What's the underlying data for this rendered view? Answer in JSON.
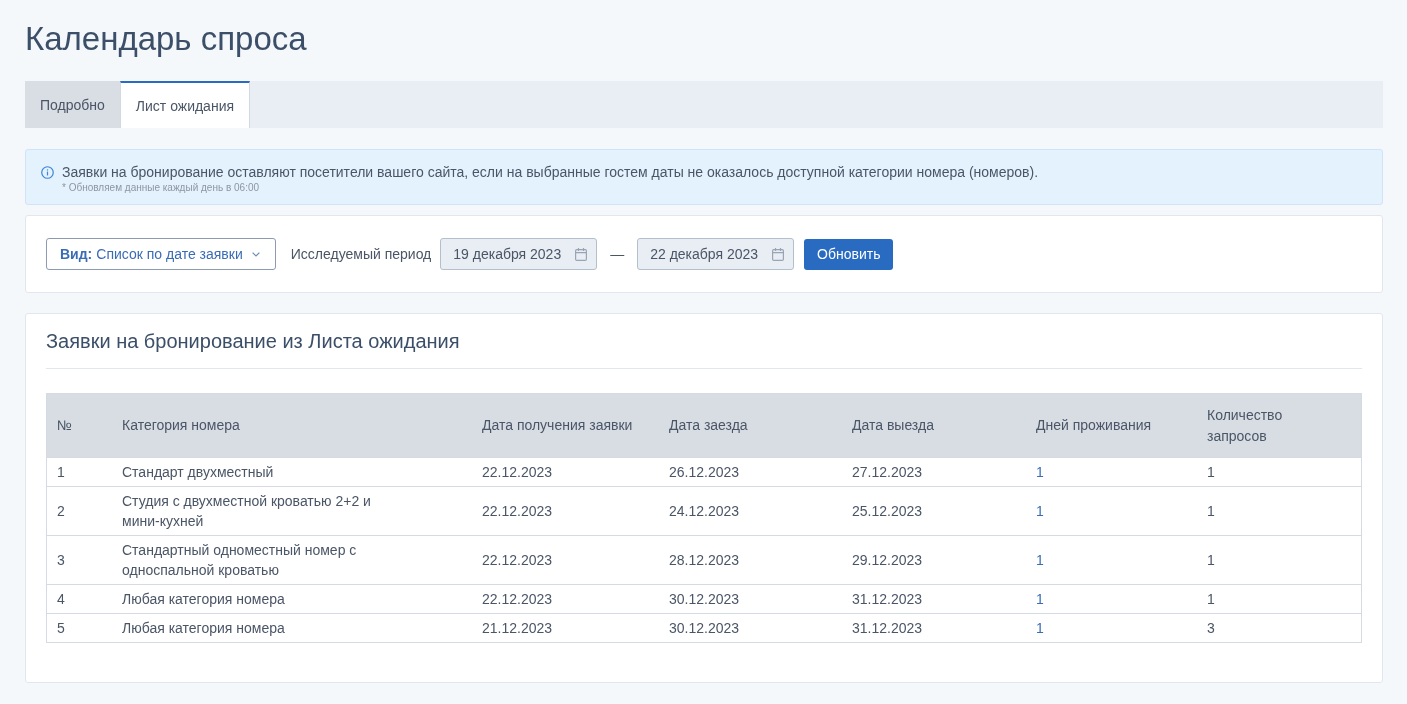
{
  "page": {
    "title": "Календарь спроса"
  },
  "tabs": [
    {
      "label": "Подробно",
      "selected": false
    },
    {
      "label": "Лист ожидания",
      "selected": true
    }
  ],
  "info": {
    "text": "Заявки на бронирование оставляют посетители вашего сайта, если на выбранные гостем даты не оказалось доступной категории номера (номеров).",
    "note": "* Обновляем данные каждый день в 06:00"
  },
  "filters": {
    "view_label": "Вид:",
    "view_value": "Список по дате заявки",
    "period_label": "Исследуемый период",
    "date_from": "19 декабря 2023",
    "separator": "—",
    "date_to": "22 декабря 2023",
    "button": "Обновить"
  },
  "table_card": {
    "title": "Заявки на бронирование из Листа ожидания",
    "columns": [
      {
        "label": "№",
        "kind": "text"
      },
      {
        "label": "Категория номера",
        "kind": "text"
      },
      {
        "label": "Дата получения заявки",
        "kind": "text"
      },
      {
        "label": "Дата заезда",
        "kind": "text"
      },
      {
        "label": "Дата выезда",
        "kind": "text"
      },
      {
        "label": "Дней проживания",
        "kind": "link"
      },
      {
        "label": "Количество запросов",
        "kind": "text"
      }
    ],
    "rows": [
      [
        "1",
        "Стандарт двухместный",
        "22.12.2023",
        "26.12.2023",
        "27.12.2023",
        "1",
        "1"
      ],
      [
        "2",
        "Студия с двухместной кроватью 2+2 и мини-кухней",
        "22.12.2023",
        "24.12.2023",
        "25.12.2023",
        "1",
        "1"
      ],
      [
        "3",
        "Стандартный одноместный номер с односпальной кроватью",
        "22.12.2023",
        "28.12.2023",
        "29.12.2023",
        "1",
        "1"
      ],
      [
        "4",
        "Любая категория номера",
        "22.12.2023",
        "30.12.2023",
        "31.12.2023",
        "1",
        "1"
      ],
      [
        "5",
        "Любая категория номера",
        "21.12.2023",
        "30.12.2023",
        "31.12.2023",
        "1",
        "3"
      ]
    ]
  }
}
